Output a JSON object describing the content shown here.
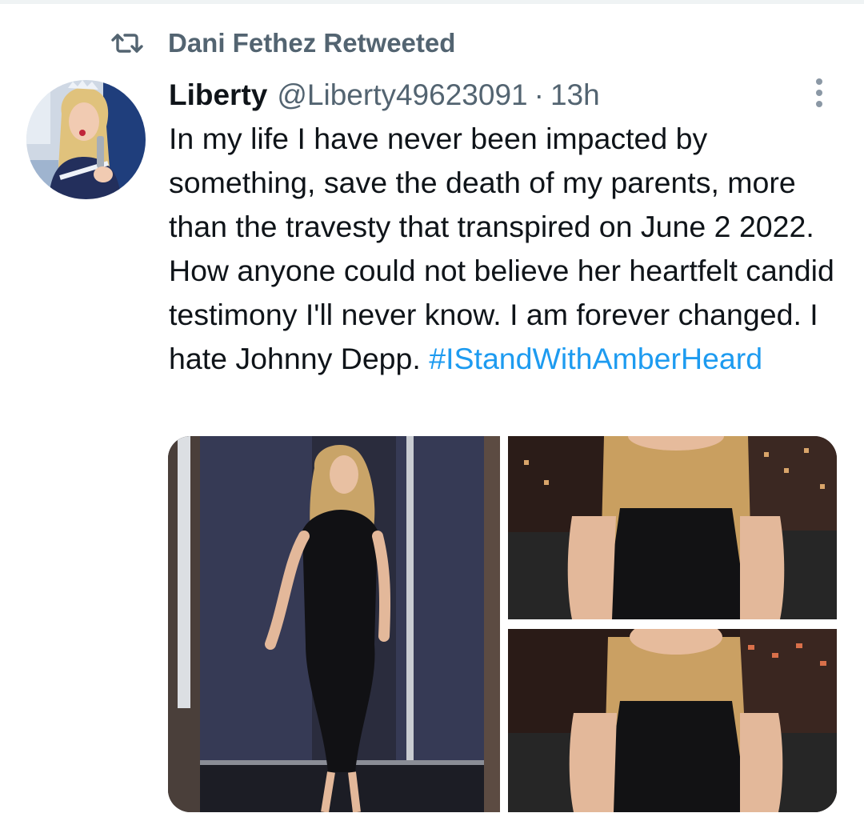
{
  "retweet": {
    "icon": "retweet-icon",
    "label": "Dani Fethez Retweeted"
  },
  "tweet": {
    "display_name": "Liberty",
    "handle": "@Liberty49623091",
    "separator": "·",
    "time": "13h",
    "more_icon": "more-vertical-icon",
    "text_before_hashtag": "In my life I have never been impacted by something, save the death of my parents, more than the travesty that transpired on June 2 2022. How anyone could not believe her heartfelt candid testimony I'll never know.  I am forever changed. I hate Johnny Depp. ",
    "hashtag": "#IStandWithAmberHeard"
  },
  "colors": {
    "text_primary": "#0f1419",
    "text_secondary": "#536471",
    "link": "#1d9bf0",
    "divider": "#eff3f4"
  }
}
